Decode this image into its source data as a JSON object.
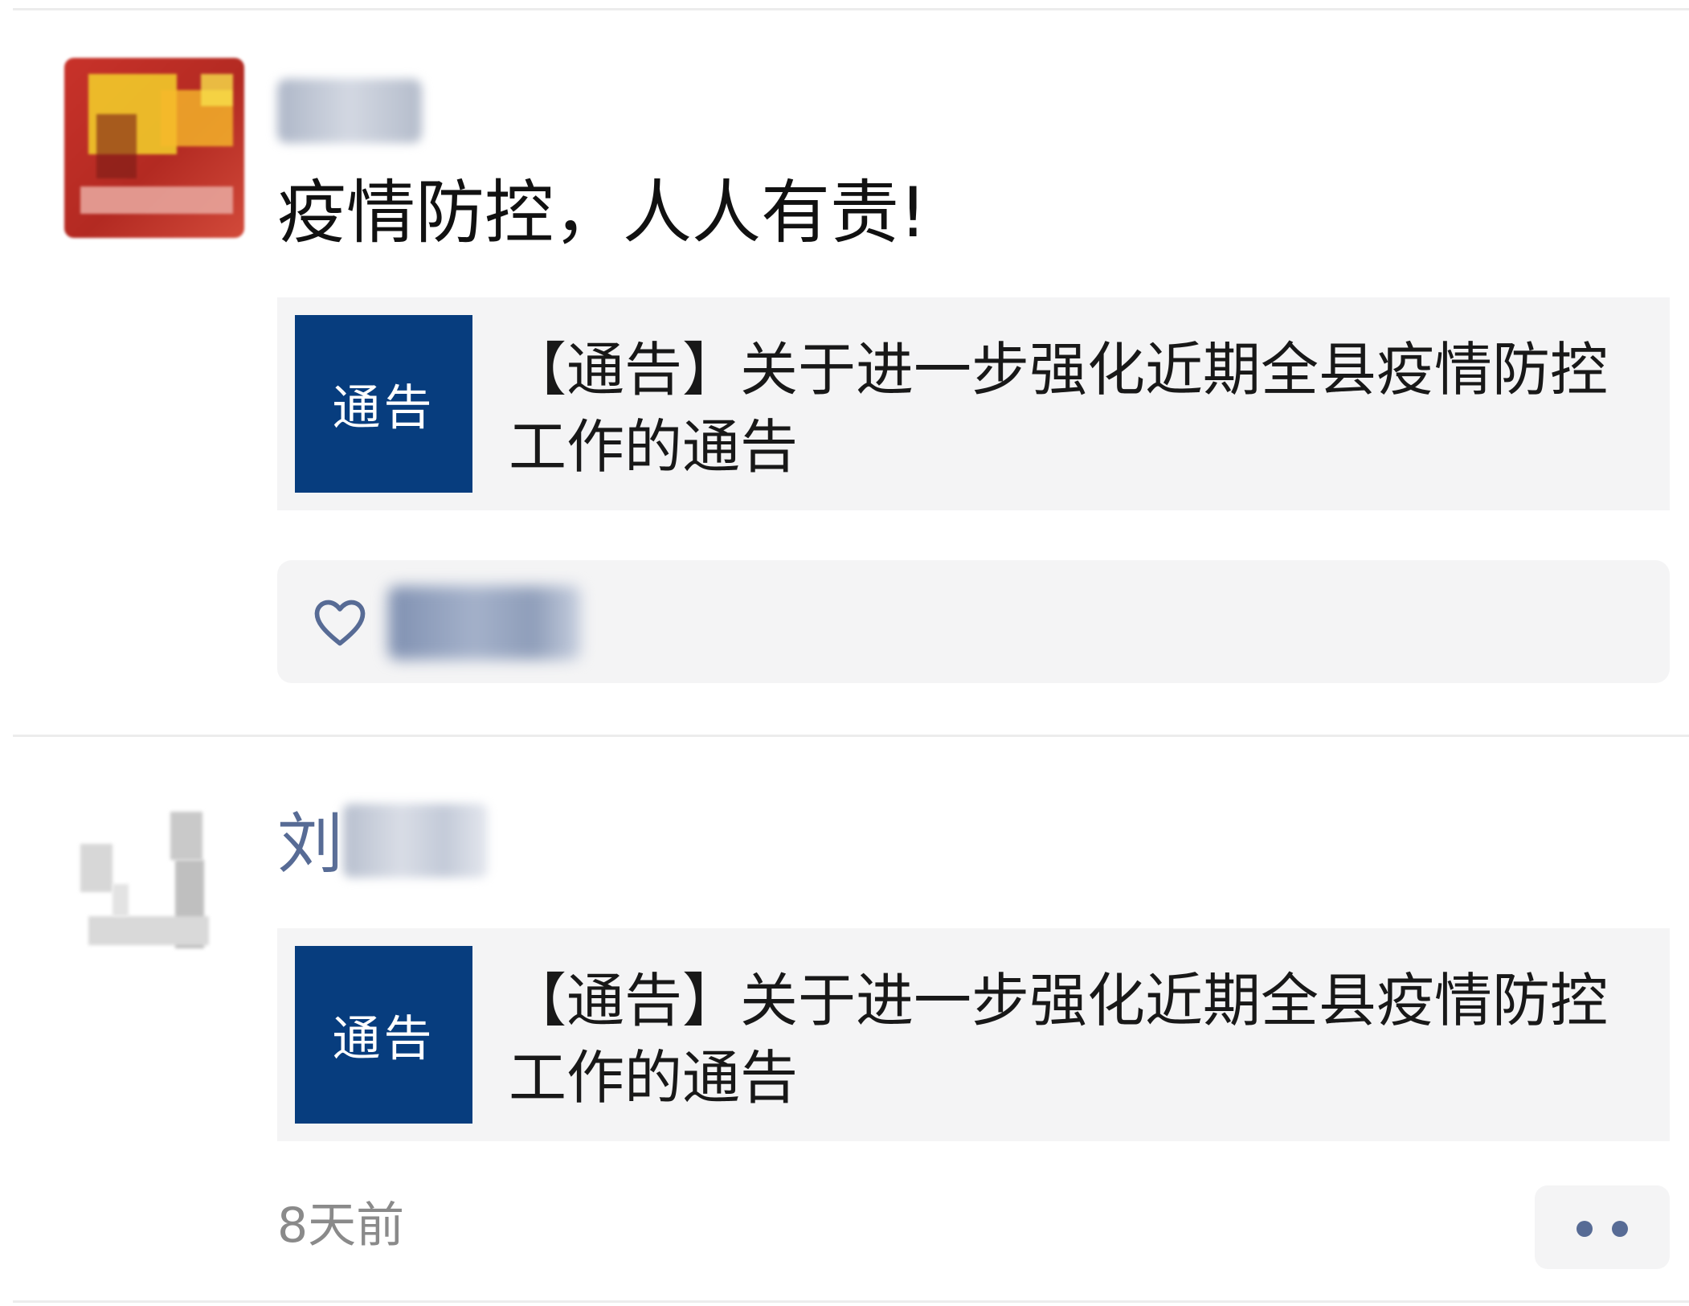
{
  "feed": {
    "posts": [
      {
        "author": "",
        "text": "疫情防控，人人有责!",
        "link": {
          "thumb_label": "通告",
          "title": "【通告】关于进一步强化近期全县疫情防控工作的通告"
        }
      },
      {
        "author": "刘",
        "link": {
          "thumb_label": "通告",
          "title": "【通告】关于进一步强化近期全县疫情防控工作的通告"
        },
        "time": "8天前"
      }
    ]
  },
  "colors": {
    "name_link": "#576b95",
    "thumb_bg": "#073d7e",
    "card_bg": "#f4f4f5",
    "time_text": "#8a8a8a"
  },
  "icons": [
    "heart-outline-icon",
    "more-dots-icon"
  ]
}
